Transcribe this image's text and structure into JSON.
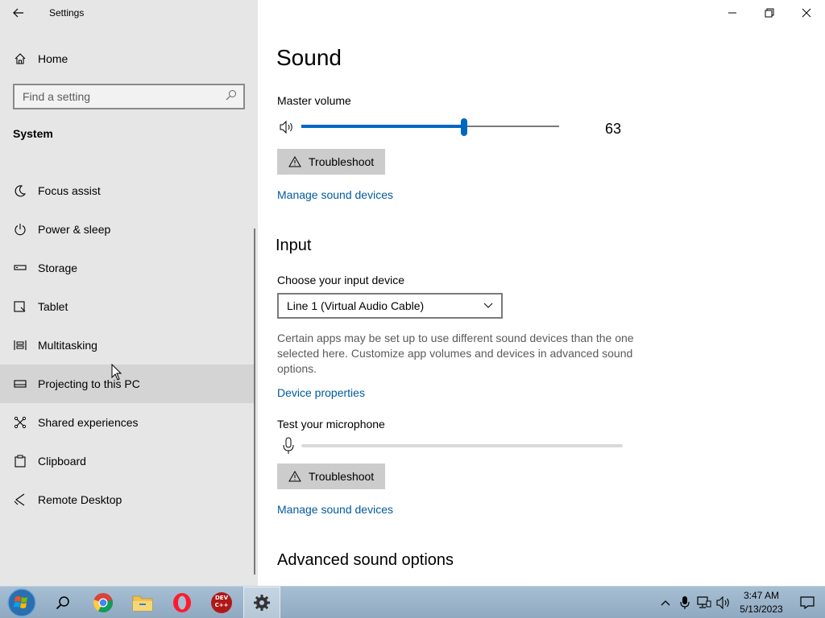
{
  "window": {
    "title": "Settings"
  },
  "sidebar": {
    "home_label": "Home",
    "search_placeholder": "Find a setting",
    "section": "System",
    "items": [
      {
        "label": "Focus assist",
        "icon": "moon-icon"
      },
      {
        "label": "Power & sleep",
        "icon": "power-icon"
      },
      {
        "label": "Storage",
        "icon": "storage-icon"
      },
      {
        "label": "Tablet",
        "icon": "tablet-icon"
      },
      {
        "label": "Multitasking",
        "icon": "multitasking-icon"
      },
      {
        "label": "Projecting to this PC",
        "icon": "projecting-icon"
      },
      {
        "label": "Shared experiences",
        "icon": "shared-experiences-icon"
      },
      {
        "label": "Clipboard",
        "icon": "clipboard-icon"
      },
      {
        "label": "Remote Desktop",
        "icon": "remote-desktop-icon"
      }
    ]
  },
  "main": {
    "title": "Sound",
    "master_volume": {
      "label": "Master volume",
      "value": "63",
      "level": 0.63
    },
    "troubleshoot_label": "Troubleshoot",
    "manage_devices_label": "Manage sound devices",
    "input": {
      "title": "Input",
      "choose_label": "Choose your input device",
      "selected_device": "Line 1 (Virtual Audio Cable)",
      "description": "Certain apps may be set up to use different sound devices than the one selected here. Customize app volumes and devices in advanced sound options.",
      "device_properties_label": "Device properties",
      "test_mic_label": "Test your microphone",
      "troubleshoot_label": "Troubleshoot",
      "manage_devices_label": "Manage sound devices"
    },
    "advanced_title": "Advanced sound options"
  },
  "taskbar": {
    "apps": [
      "start-orb-icon",
      "search-icon",
      "chrome-icon",
      "file-explorer-icon",
      "opera-icon",
      "dev-cpp-icon",
      "settings-icon"
    ],
    "dev_cpp_text": "DEV C++",
    "time": "3:47 AM",
    "date": "5/13/2023"
  },
  "colors": {
    "accent": "#0067c0",
    "link": "#005a9e",
    "sidebar_bg": "#e6e6e6"
  }
}
